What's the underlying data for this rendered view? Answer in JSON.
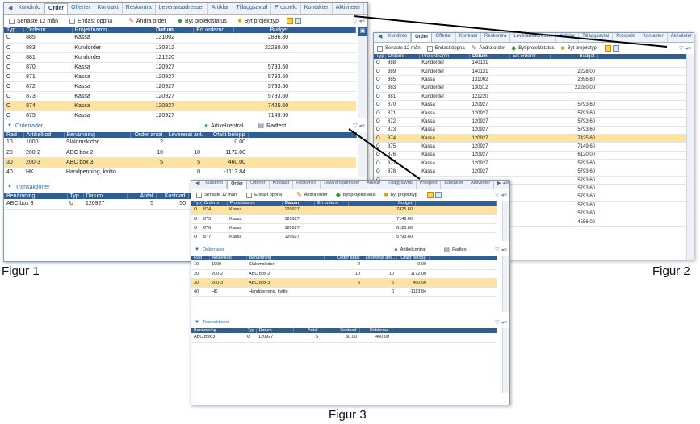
{
  "tabs": [
    "Kundinfo",
    "Order",
    "Offerter",
    "Kontrakt",
    "Reskontra",
    "Leveransadresser",
    "Artiklar",
    "Tilläggsavtal",
    "Prospekt",
    "Kontakter",
    "Aktiviteter"
  ],
  "active_tab": "Order",
  "toolbar": {
    "last12": "Senaste 12 mån",
    "only_open": "Endast öppna",
    "change_order": "Ändra order",
    "switch_status": "Byt projektstatus",
    "switch_type": "Byt projekttyp"
  },
  "orders_headers": {
    "typ": "Typ",
    "ordernr": "Ordernr",
    "projekt": "Projektnamn",
    "datum": "Datum",
    "ert": "Ert ordernr",
    "budget": "Budget"
  },
  "fig1_orders": [
    {
      "typ": "O",
      "nr": "885",
      "namn": "Kassa",
      "datum": "131002",
      "ert": "",
      "budget": "2896.80",
      "sel": false
    },
    {
      "typ": "O",
      "nr": "883",
      "namn": "Kundorder",
      "datum": "130312",
      "ert": "",
      "budget": "22280.00",
      "sel": false
    },
    {
      "typ": "O",
      "nr": "881",
      "namn": "Kundorder",
      "datum": "121220",
      "ert": "",
      "budget": "",
      "sel": false
    },
    {
      "typ": "O",
      "nr": "870",
      "namn": "Kassa",
      "datum": "120927",
      "ert": "",
      "budget": "5793.60",
      "sel": false
    },
    {
      "typ": "O",
      "nr": "871",
      "namn": "Kassa",
      "datum": "120927",
      "ert": "",
      "budget": "5793.60",
      "sel": false
    },
    {
      "typ": "O",
      "nr": "872",
      "namn": "Kassa",
      "datum": "120927",
      "ert": "",
      "budget": "5793.60",
      "sel": false
    },
    {
      "typ": "O",
      "nr": "873",
      "namn": "Kassa",
      "datum": "120927",
      "ert": "",
      "budget": "5793.60",
      "sel": false
    },
    {
      "typ": "O",
      "nr": "874",
      "namn": "Kassa",
      "datum": "120927",
      "ert": "",
      "budget": "7425.60",
      "sel": true
    },
    {
      "typ": "O",
      "nr": "875",
      "namn": "Kassa",
      "datum": "120927",
      "ert": "",
      "budget": "7149.60",
      "sel": false
    }
  ],
  "fig2_orders": [
    {
      "typ": "O",
      "nr": "888",
      "namn": "Kundorder",
      "datum": "140131",
      "ert": "",
      "budget": "",
      "sel": false
    },
    {
      "typ": "O",
      "nr": "889",
      "namn": "Kundorder",
      "datum": "140131",
      "ert": "",
      "budget": "2228.00",
      "sel": false
    },
    {
      "typ": "O",
      "nr": "885",
      "namn": "Kassa",
      "datum": "131002",
      "ert": "",
      "budget": "2896.80",
      "sel": false
    },
    {
      "typ": "O",
      "nr": "883",
      "namn": "Kundorder",
      "datum": "130312",
      "ert": "",
      "budget": "22280.00",
      "sel": false
    },
    {
      "typ": "O",
      "nr": "881",
      "namn": "Kundorder",
      "datum": "121220",
      "ert": "",
      "budget": "",
      "sel": false
    },
    {
      "typ": "O",
      "nr": "870",
      "namn": "Kassa",
      "datum": "120927",
      "ert": "",
      "budget": "5793.60",
      "sel": false
    },
    {
      "typ": "O",
      "nr": "871",
      "namn": "Kassa",
      "datum": "120927",
      "ert": "",
      "budget": "5793.60",
      "sel": false
    },
    {
      "typ": "O",
      "nr": "872",
      "namn": "Kassa",
      "datum": "120927",
      "ert": "",
      "budget": "5793.60",
      "sel": false
    },
    {
      "typ": "O",
      "nr": "873",
      "namn": "Kassa",
      "datum": "120927",
      "ert": "",
      "budget": "5793.60",
      "sel": false
    },
    {
      "typ": "O",
      "nr": "874",
      "namn": "Kassa",
      "datum": "120927",
      "ert": "",
      "budget": "7425.60",
      "sel": true
    },
    {
      "typ": "O",
      "nr": "875",
      "namn": "Kassa",
      "datum": "120927",
      "ert": "",
      "budget": "7149.60",
      "sel": false
    },
    {
      "typ": "O",
      "nr": "876",
      "namn": "Kassa",
      "datum": "120927",
      "ert": "",
      "budget": "6120.00",
      "sel": false
    },
    {
      "typ": "O",
      "nr": "877",
      "namn": "Kassa",
      "datum": "120927",
      "ert": "",
      "budget": "5793.60",
      "sel": false
    },
    {
      "typ": "O",
      "nr": "878",
      "namn": "Kassa",
      "datum": "120927",
      "ert": "",
      "budget": "5793.60",
      "sel": false
    },
    {
      "typ": "O",
      "nr": "",
      "namn": "",
      "datum": "",
      "ert": "",
      "budget": "5793.60",
      "sel": false
    },
    {
      "typ": "O",
      "nr": "",
      "namn": "",
      "datum": "",
      "ert": "",
      "budget": "5793.60",
      "sel": false
    },
    {
      "typ": "O",
      "nr": "",
      "namn": "",
      "datum": "",
      "ert": "",
      "budget": "5793.60",
      "sel": false
    },
    {
      "typ": "O",
      "nr": "",
      "namn": "",
      "datum": "",
      "ert": "",
      "budget": "5793.60",
      "sel": false
    },
    {
      "typ": "O",
      "nr": "",
      "namn": "",
      "datum": "",
      "ert": "",
      "budget": "5793.60",
      "sel": false
    },
    {
      "typ": "O",
      "nr": "",
      "namn": "",
      "datum": "",
      "ert": "",
      "budget": "4556.00",
      "sel": false
    }
  ],
  "fig3_orders": [
    {
      "typ": "O",
      "nr": "874",
      "namn": "Kassa",
      "datum": "120927",
      "ert": "",
      "budget": "7425.60",
      "sel": true
    },
    {
      "typ": "O",
      "nr": "875",
      "namn": "Kassa",
      "datum": "120927",
      "ert": "",
      "budget": "7149.60",
      "sel": false
    },
    {
      "typ": "O",
      "nr": "876",
      "namn": "Kassa",
      "datum": "120927",
      "ert": "",
      "budget": "6120.00",
      "sel": false
    },
    {
      "typ": "O",
      "nr": "877",
      "namn": "Kassa",
      "datum": "120927",
      "ert": "",
      "budget": "5793.60",
      "sel": false
    }
  ],
  "orderrader": {
    "title": "Orderrader",
    "artikelcentral": "Artikelcentral",
    "radtext": "Radtext",
    "headers": {
      "rad": "Rad",
      "artnr": "Artikelkod",
      "ben": "Benämning",
      "antal": "Order antal",
      "lev": "Levererat ant...",
      "belopp": "Ofakt belopp"
    },
    "rows": [
      {
        "rad": "10",
        "artnr": "1000",
        "ben": "Slalomskidor",
        "antal": "2",
        "lev": "",
        "belopp": "0.00",
        "sel": false
      },
      {
        "rad": "20",
        "artnr": "200-2",
        "ben": "ABC box 2",
        "antal": "10",
        "lev": "10",
        "belopp": "1172.00",
        "sel": false
      },
      {
        "rad": "30",
        "artnr": "200-3",
        "ben": "ABC box 3",
        "antal": "5",
        "lev": "5",
        "belopp": "460.00",
        "sel": true
      },
      {
        "rad": "40",
        "artnr": "HK",
        "ben": "Handpenning, kvitto",
        "antal": "",
        "lev": "0",
        "belopp": "-1113.84",
        "sel": false
      }
    ]
  },
  "transaktioner": {
    "title": "Transaktioner",
    "headers": {
      "ben": "Benämning",
      "typ": "Typ",
      "datum": "Datum",
      "antal": "Antal",
      "kost": "Kostnad",
      "deb": "Debiteras"
    },
    "rows": [
      {
        "ben": "ABC box 3",
        "typ": "U",
        "datum": "120927",
        "antal": "5",
        "kost": "50.00",
        "deb": "460.00"
      }
    ],
    "fig1_kost_partial": "50"
  },
  "figures": {
    "f1": "Figur 1",
    "f2": "Figur 2",
    "f3": "Figur 3"
  }
}
